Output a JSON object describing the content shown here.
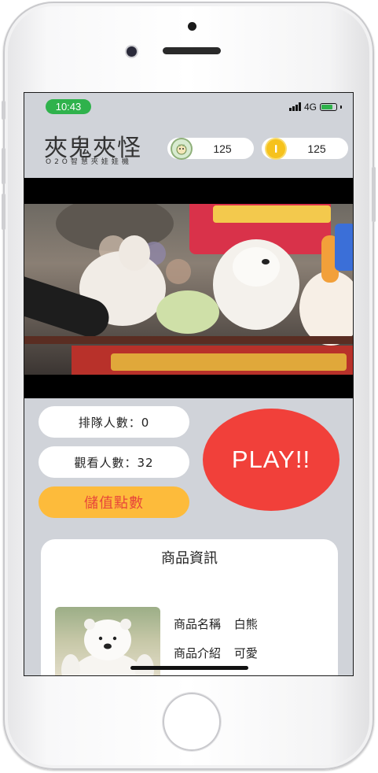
{
  "status_bar": {
    "time": "10:43",
    "network": "4G",
    "battery_level": 0.7
  },
  "header": {
    "app_title": "夾鬼夾怪",
    "app_subtitle": "O2O智慧夾娃娃機",
    "points_value": "125",
    "coins_value": "125"
  },
  "queue": {
    "queue_text": "排隊人數：0",
    "viewers_text": "觀看人數：32",
    "topup_label": "儲值點數",
    "play_label": "PLAY!!"
  },
  "product": {
    "section_title": "商品資訊",
    "name_label": "商品名稱",
    "name_value": "白熊",
    "desc_label": "商品介紹",
    "desc_value": "可愛"
  },
  "icons": {
    "points": "character-avatar-icon",
    "coins": "gold-coin-icon"
  },
  "colors": {
    "time_pill": "#2fb24c",
    "screen_bg": "#d0d3d9",
    "play_button": "#f1403a",
    "topup_button": "#fdbb3b",
    "topup_text": "#e8463a",
    "coin": "#f6c21c"
  }
}
